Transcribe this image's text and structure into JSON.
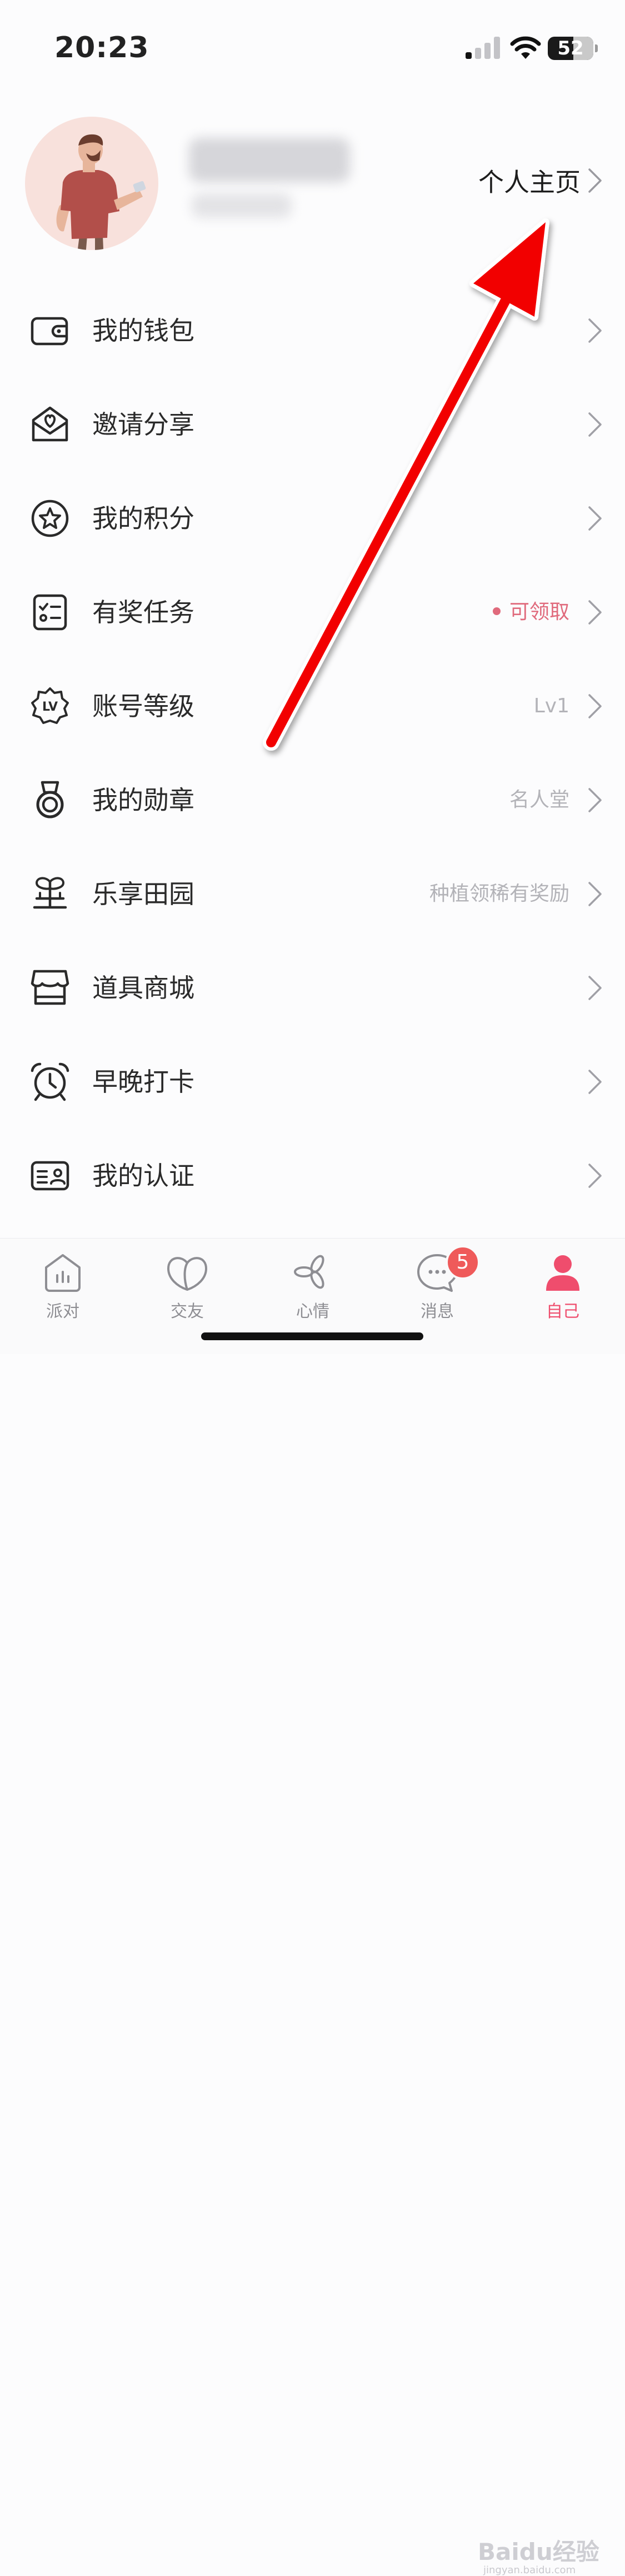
{
  "status": {
    "time": "20:23",
    "battery": "52"
  },
  "profile": {
    "homepage_label": "个人主页"
  },
  "menu": [
    {
      "label": "我的钱包",
      "right": ""
    },
    {
      "label": "邀请分享",
      "right": ""
    },
    {
      "label": "我的积分",
      "right": ""
    },
    {
      "label": "有奖任务",
      "right": "可领取"
    },
    {
      "label": "账号等级",
      "right": "Lv1"
    },
    {
      "label": "我的勋章",
      "right": "名人堂"
    },
    {
      "label": "乐享田园",
      "right": "种植领稀有奖励"
    },
    {
      "label": "道具商城",
      "right": ""
    },
    {
      "label": "早晚打卡",
      "right": ""
    },
    {
      "label": "我的认证",
      "right": ""
    }
  ],
  "tabs": [
    {
      "label": "派对",
      "icon": "party-icon"
    },
    {
      "label": "交友",
      "icon": "friends-icon"
    },
    {
      "label": "心情",
      "icon": "mood-icon"
    },
    {
      "label": "消息",
      "icon": "message-icon",
      "badge": "5"
    },
    {
      "label": "自己",
      "icon": "me-icon",
      "active": true
    }
  ],
  "watermark": {
    "text": "Baidu经验",
    "sub": "jingyan.baidu.com"
  },
  "colors": {
    "accent": "#ef4d6d",
    "arrow": "#ff0000",
    "badge": "#ef5a5a"
  }
}
